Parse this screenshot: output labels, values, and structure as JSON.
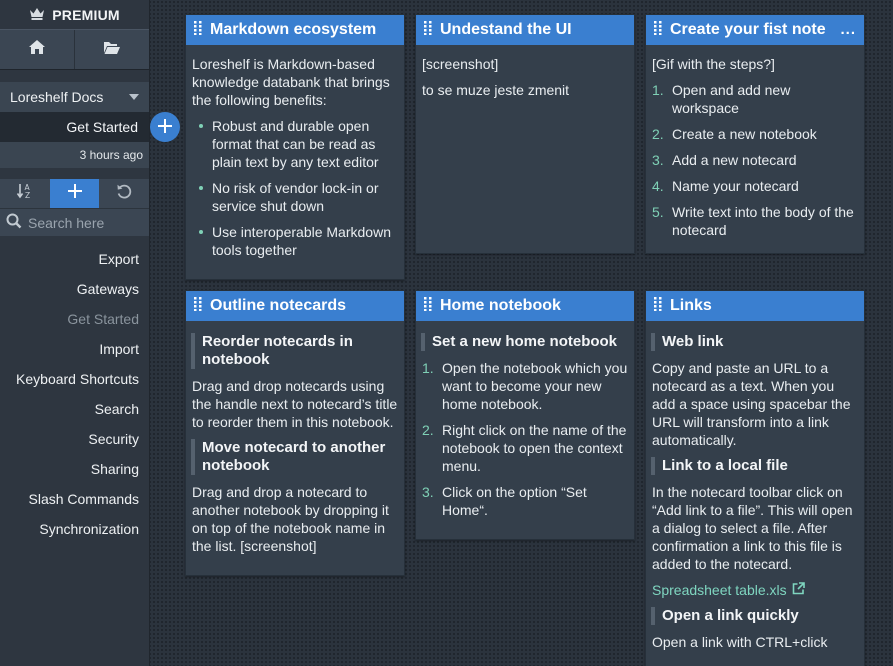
{
  "sidebar": {
    "premium_label": "PREMIUM",
    "notebook_select": "Loreshelf Docs",
    "current_note": "Get Started",
    "timestamp": "3 hours ago",
    "search_placeholder": "Search here",
    "menu": [
      "Export",
      "Gateways",
      "Get Started",
      "Import",
      "Keyboard Shortcuts",
      "Search",
      "Security",
      "Sharing",
      "Slash Commands",
      "Synchronization"
    ]
  },
  "cards": {
    "markdown": {
      "title": "Markdown ecosystem",
      "intro": "Loreshelf is Markdown-based knowledge databank that brings the following benefits:",
      "bullets": [
        "Robust and durable open format that can be read as plain text by any text editor",
        "No risk of vendor lock-in or service shut down",
        "Use interoperable Markdown tools together"
      ]
    },
    "ui": {
      "title": "Undestand the UI",
      "line1": "[screenshot]",
      "line2": "to se muze jeste zmenit"
    },
    "first_note": {
      "title": "Create your fist note",
      "more": "...",
      "intro": "[Gif with the steps?]",
      "steps": [
        "Open and add new workspace",
        "Create a new notebook",
        "Add a new notecard",
        "Name your notecard",
        "Write text into the body of the notecard"
      ]
    },
    "outline": {
      "title": "Outline notecards",
      "h1": "Reorder notecards in notebook",
      "p1": "Drag and drop notecards using the handle next to notecard’s title to reorder them in this notebook.",
      "h2": "Move notecard to another notebook",
      "p2": "Drag and drop a notecard to another notebook by dropping it on top of the notebook name in the list. [screenshot]"
    },
    "home": {
      "title": "Home notebook",
      "h1": "Set a new home notebook",
      "steps": [
        "Open the notebook which you want to become your new home notebook.",
        "Right click on the name of the notebook to open the context menu.",
        "Click on the option “Set Home“."
      ]
    },
    "links": {
      "title": "Links",
      "h1": "Web link",
      "p1": "Copy and paste an URL to a notecard as a text. When you add a space using spacebar the URL will transform into a link automatically.",
      "h2": "Link to a local file",
      "p2": "In the notecard toolbar click on “Add link to a file”. This will open a dialog to select a file. After confirmation a link to this file is added to the notecard.",
      "file_link": "Spreadsheet table.xls",
      "h3": "Open a link quickly",
      "p3": "Open a link with CTRL+click"
    }
  }
}
